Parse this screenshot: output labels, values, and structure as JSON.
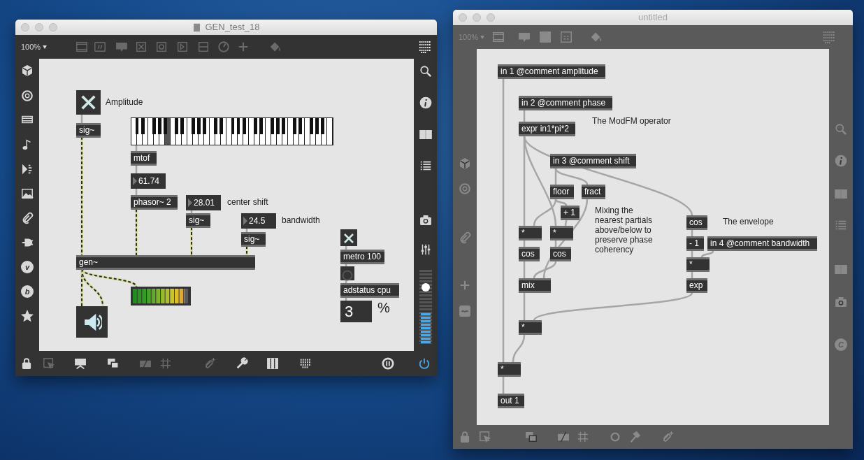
{
  "windows": [
    {
      "title": "GEN_test_18",
      "document_icon": true,
      "active": true,
      "zoom": "100%",
      "left_sidebar_letters": [
        "v",
        "b"
      ],
      "volume": {
        "level": 0.76
      },
      "objects": [
        {
          "kind": "toggle",
          "checked": true
        },
        {
          "kind": "comment",
          "text": "Amplitude"
        },
        {
          "kind": "keyboard",
          "white_keys": [
            {
              "pressed": false
            },
            {
              "pressed": false
            },
            {
              "pressed": false
            },
            {
              "pressed": false
            },
            {
              "pressed": false
            },
            {
              "pressed": false
            },
            {
              "pressed": true
            },
            {
              "pressed": false
            },
            {
              "pressed": false
            },
            {
              "pressed": false
            },
            {
              "pressed": false
            },
            {
              "pressed": false
            },
            {
              "pressed": false
            },
            {
              "pressed": false
            },
            {
              "pressed": false
            },
            {
              "pressed": false
            },
            {
              "pressed": false
            },
            {
              "pressed": false
            },
            {
              "pressed": false
            },
            {
              "pressed": false
            },
            {
              "pressed": false
            },
            {
              "pressed": false
            },
            {
              "pressed": false
            },
            {
              "pressed": false
            },
            {
              "pressed": false
            },
            {
              "pressed": false
            },
            {
              "pressed": false
            },
            {
              "pressed": false
            },
            {
              "pressed": false
            },
            {
              "pressed": false
            },
            {
              "pressed": false
            },
            {
              "pressed": false
            },
            {
              "pressed": false
            },
            {
              "pressed": false
            },
            {
              "pressed": false
            },
            {
              "pressed": false
            }
          ]
        },
        {
          "kind": "box",
          "text": "sig~"
        },
        {
          "kind": "box",
          "text": "mtof"
        },
        {
          "kind": "number",
          "text": "61.74"
        },
        {
          "kind": "box",
          "text": "phasor~ 2"
        },
        {
          "kind": "number",
          "text": "28.01"
        },
        {
          "kind": "comment",
          "text": "center shift"
        },
        {
          "kind": "box",
          "text": "sig~"
        },
        {
          "kind": "number",
          "text": "24.5"
        },
        {
          "kind": "comment",
          "text": "bandwidth"
        },
        {
          "kind": "toggle",
          "checked": true
        },
        {
          "kind": "box",
          "text": "sig~"
        },
        {
          "kind": "box",
          "text": "metro 100"
        },
        {
          "kind": "box",
          "text": "gen~"
        },
        {
          "kind": "bang",
          "on": false
        },
        {
          "kind": "box",
          "text": "adstatus cpu"
        },
        {
          "kind": "meter",
          "level": 0.92
        },
        {
          "kind": "readout",
          "text": "3"
        },
        {
          "kind": "comment",
          "text": "%"
        },
        {
          "kind": "ezdac"
        }
      ]
    },
    {
      "title": "untitled",
      "active": false,
      "zoom": "100%",
      "right_sidebar_letters": [
        "C"
      ],
      "objects": [
        {
          "kind": "box",
          "text": "in 1 @comment amplitude"
        },
        {
          "kind": "box",
          "text": "in 2 @comment phase"
        },
        {
          "kind": "comment",
          "text": "The ModFM operator"
        },
        {
          "kind": "box",
          "text": "expr in1*pi*2"
        },
        {
          "kind": "box",
          "text": "in 3 @comment shift"
        },
        {
          "kind": "box",
          "text": "floor"
        },
        {
          "kind": "box",
          "text": "fract"
        },
        {
          "kind": "box",
          "text": "+ 1"
        },
        {
          "kind": "comment",
          "text": "Mixing the nearest partials above/below to preserve phase coherency"
        },
        {
          "kind": "box",
          "text": "cos"
        },
        {
          "kind": "comment",
          "text": "The envelope"
        },
        {
          "kind": "box",
          "text": "*"
        },
        {
          "kind": "box",
          "text": "*"
        },
        {
          "kind": "box",
          "text": "- 1"
        },
        {
          "kind": "box",
          "text": "in 4 @comment bandwidth"
        },
        {
          "kind": "box",
          "text": "cos"
        },
        {
          "kind": "box",
          "text": "cos"
        },
        {
          "kind": "box",
          "text": "*"
        },
        {
          "kind": "box",
          "text": "mix"
        },
        {
          "kind": "box",
          "text": "exp"
        },
        {
          "kind": "box",
          "text": "*"
        },
        {
          "kind": "box",
          "text": "*"
        },
        {
          "kind": "box",
          "text": "out 1"
        }
      ]
    }
  ]
}
